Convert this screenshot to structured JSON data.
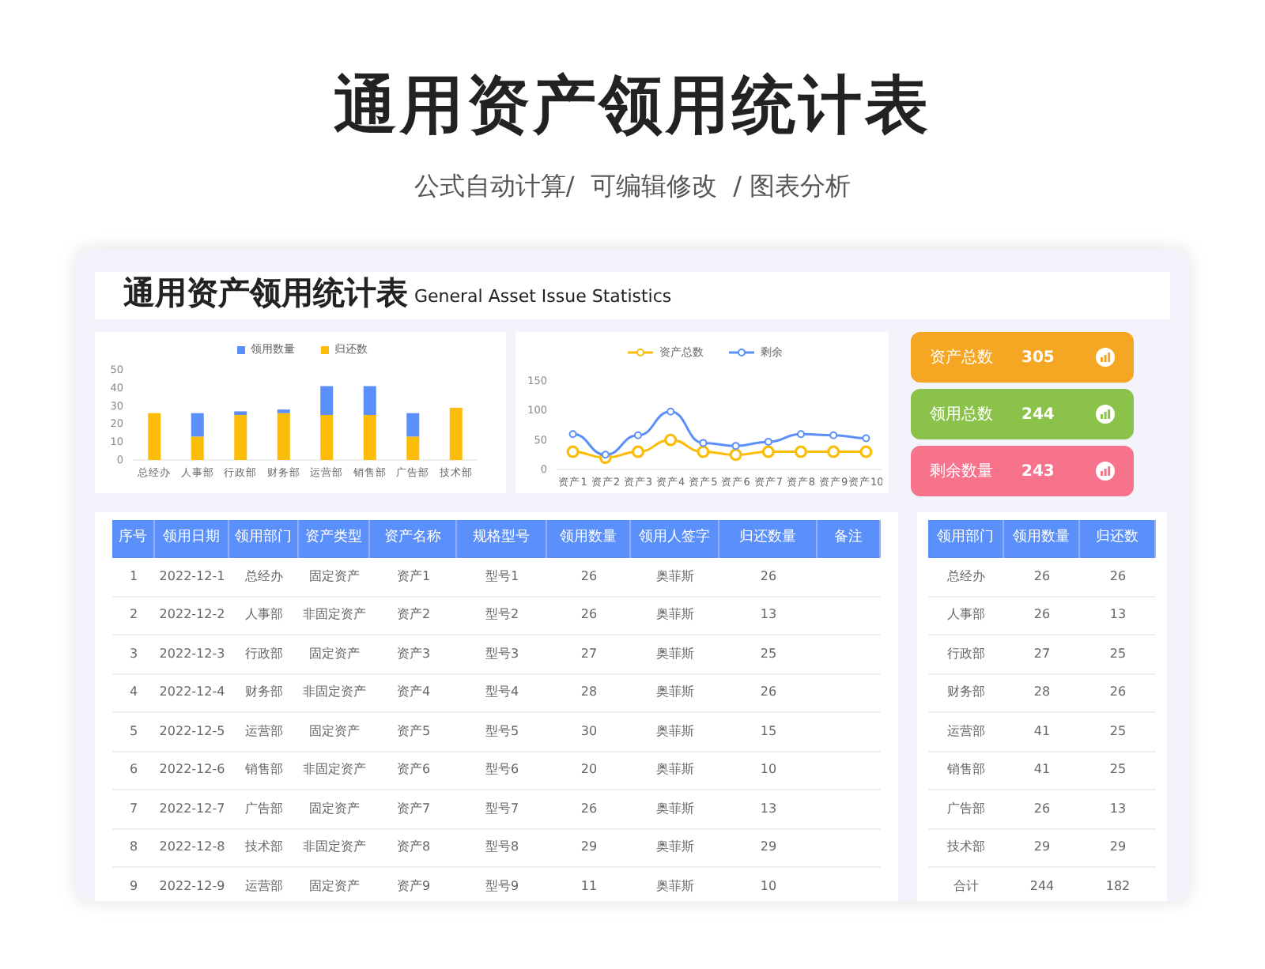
{
  "title": "通用资产领用统计表",
  "subtitle": "公式自动计算/  可编辑修改  / 图表分析",
  "sheet": {
    "title": "通用资产领用统计表",
    "title_en": "General Asset Issue Statistics"
  },
  "bar_chart": {
    "chart_data": {
      "type": "bar",
      "categories": [
        "总经办",
        "人事部",
        "行政部",
        "财务部",
        "运营部",
        "销售部",
        "广告部",
        "技术部"
      ],
      "series": [
        {
          "name": "领用数量",
          "color": "#5b8ff9",
          "values": [
            0,
            13,
            2,
            2,
            16,
            16,
            13,
            0
          ]
        },
        {
          "name": "归还数",
          "color": "#fbbd08",
          "values": [
            26,
            13,
            25,
            26,
            25,
            25,
            13,
            29
          ]
        }
      ],
      "ylim": [
        0,
        50
      ],
      "yticks": [
        0,
        10,
        20,
        30,
        40,
        50
      ],
      "stacked": true,
      "legend": "top"
    }
  },
  "line_chart": {
    "chart_data": {
      "type": "line",
      "categories": [
        "资产1",
        "资产2",
        "资产3",
        "资产4",
        "资产5",
        "资产6",
        "资产7",
        "资产8",
        "资产9",
        "资产10"
      ],
      "series": [
        {
          "name": "资产总数",
          "color": "#fbbd08",
          "marker": "circle",
          "values": [
            30,
            20,
            30,
            50,
            30,
            25,
            30,
            30,
            30,
            30
          ]
        },
        {
          "name": "剩余",
          "color": "#5b8ff9",
          "marker": "circle",
          "values": [
            60,
            25,
            58,
            98,
            45,
            40,
            47,
            60,
            58,
            53
          ]
        }
      ],
      "ylim": [
        0,
        150
      ],
      "yticks": [
        0,
        50,
        100,
        150
      ],
      "legend": "top"
    }
  },
  "stats": [
    {
      "label": "资产总数",
      "value": "305",
      "color": "#f5a623"
    },
    {
      "label": "领用总数",
      "value": "244",
      "color": "#8bc34a"
    },
    {
      "label": "剩余数量",
      "value": "243",
      "color": "#f7738c"
    }
  ],
  "table": {
    "columns": [
      "序号",
      "领用日期",
      "领用部门",
      "资产类型",
      "资产名称",
      "规格型号",
      "领用数量",
      "领用人签字",
      "归还数量",
      "备注"
    ],
    "rows": [
      [
        "1",
        "2022-12-1",
        "总经办",
        "固定资产",
        "资产1",
        "型号1",
        "26",
        "奥菲斯",
        "26"
      ],
      [
        "2",
        "2022-12-2",
        "人事部",
        "非固定资产",
        "资产2",
        "型号2",
        "26",
        "奥菲斯",
        "13"
      ],
      [
        "3",
        "2022-12-3",
        "行政部",
        "固定资产",
        "资产3",
        "型号3",
        "27",
        "奥菲斯",
        "25"
      ],
      [
        "4",
        "2022-12-4",
        "财务部",
        "非固定资产",
        "资产4",
        "型号4",
        "28",
        "奥菲斯",
        "26"
      ],
      [
        "5",
        "2022-12-5",
        "运营部",
        "固定资产",
        "资产5",
        "型号5",
        "30",
        "奥菲斯",
        "15"
      ],
      [
        "6",
        "2022-12-6",
        "销售部",
        "非固定资产",
        "资产6",
        "型号6",
        "20",
        "奥菲斯",
        "10"
      ],
      [
        "7",
        "2022-12-7",
        "广告部",
        "固定资产",
        "资产7",
        "型号7",
        "26",
        "奥菲斯",
        "13"
      ],
      [
        "8",
        "2022-12-8",
        "技术部",
        "非固定资产",
        "资产8",
        "型号8",
        "29",
        "奥菲斯",
        "29"
      ],
      [
        "9",
        "2022-12-9",
        "运营部",
        "固定资产",
        "资产9",
        "型号9",
        "11",
        "奥菲斯",
        "10"
      ]
    ]
  },
  "summary": {
    "columns": [
      "领用部门",
      "领用数量",
      "归还数"
    ],
    "rows": [
      [
        "总经办",
        "26",
        "26"
      ],
      [
        "人事部",
        "26",
        "13"
      ],
      [
        "行政部",
        "27",
        "25"
      ],
      [
        "财务部",
        "28",
        "26"
      ],
      [
        "运营部",
        "41",
        "25"
      ],
      [
        "销售部",
        "41",
        "25"
      ],
      [
        "广告部",
        "26",
        "13"
      ],
      [
        "技术部",
        "29",
        "29"
      ],
      [
        "合计",
        "244",
        "182"
      ]
    ]
  }
}
